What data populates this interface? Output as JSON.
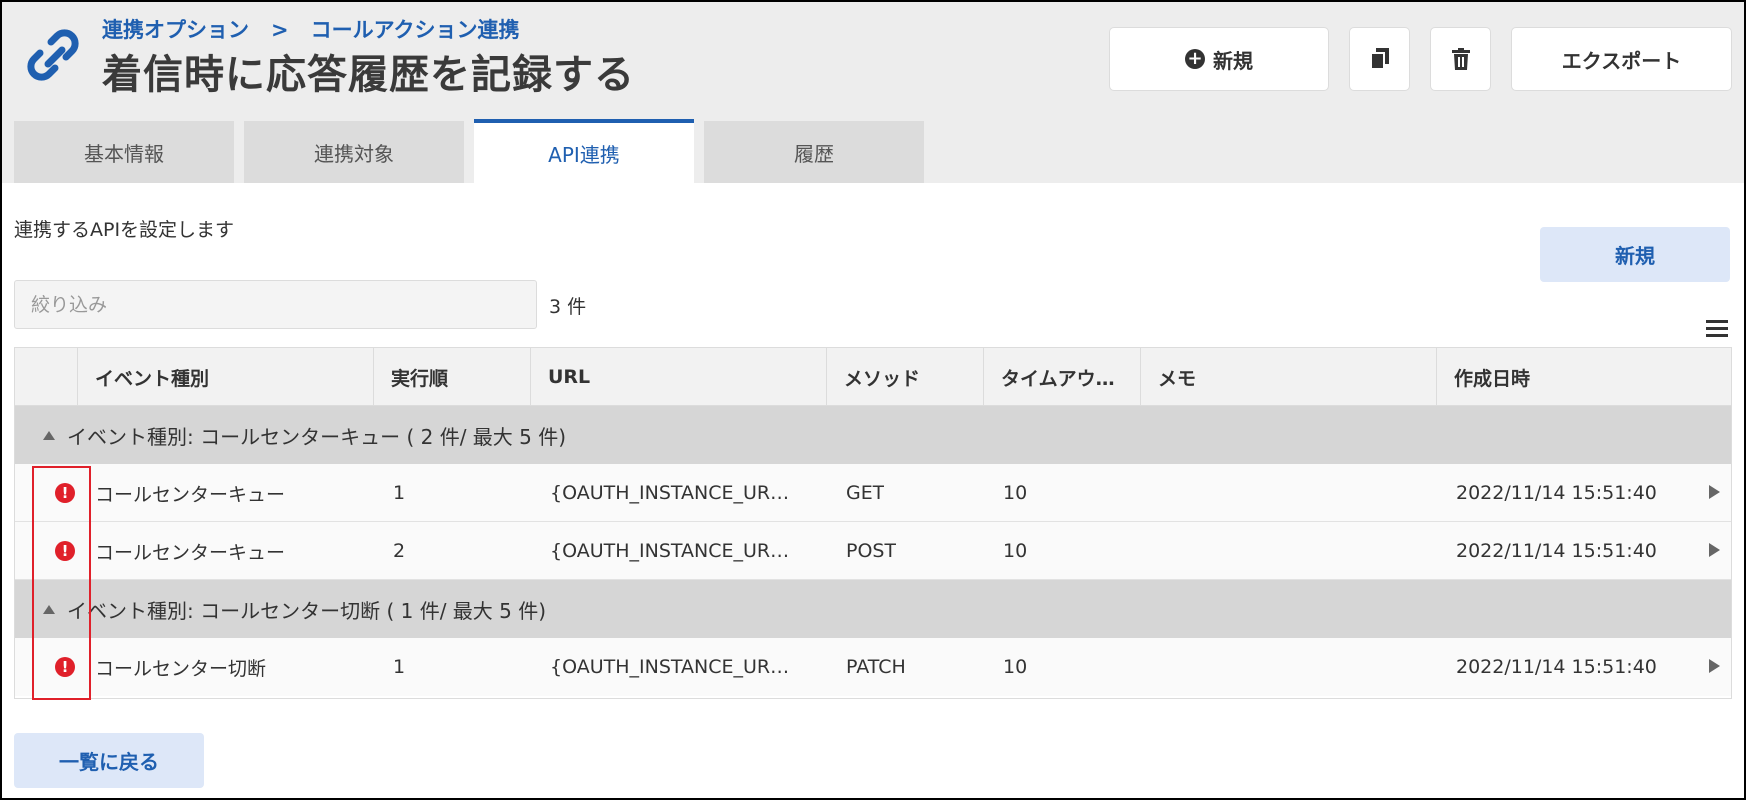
{
  "header": {
    "breadcrumb": [
      "連携オプション",
      "コールアクション連携"
    ],
    "breadcrumb_separator": ">",
    "title": "着信時に応答履歴を記録する",
    "icon": "link-icon",
    "actions": {
      "new_label": "新規",
      "copy_icon": "copy-icon",
      "delete_icon": "trash-icon",
      "export_label": "エクスポート"
    }
  },
  "tabs": [
    {
      "label": "基本情報",
      "active": false
    },
    {
      "label": "連携対象",
      "active": false
    },
    {
      "label": "API連携",
      "active": true
    },
    {
      "label": "履歴",
      "active": false
    }
  ],
  "content": {
    "description": "連携するAPIを設定します",
    "new_button": "新規",
    "filter_placeholder": "絞り込み",
    "count": "3 件",
    "back_button": "一覧に戻る"
  },
  "table": {
    "columns": [
      "イベント種別",
      "実行順",
      "URL",
      "メソッド",
      "タイムアウ…",
      "メモ",
      "作成日時"
    ],
    "groups": [
      {
        "label": "イベント種別: コールセンターキュー ( 2 件/ 最大 5 件)",
        "rows": [
          {
            "event": "コールセンターキュー",
            "order": "1",
            "url": "{OAUTH_INSTANCE_UR…",
            "method": "GET",
            "timeout": "10",
            "memo": "",
            "created": "2022/11/14 15:51:40"
          },
          {
            "event": "コールセンターキュー",
            "order": "2",
            "url": "{OAUTH_INSTANCE_UR…",
            "method": "POST",
            "timeout": "10",
            "memo": "",
            "created": "2022/11/14 15:51:40"
          }
        ]
      },
      {
        "label": "イベント種別: コールセンター切断 ( 1 件/ 最大 5 件)",
        "rows": [
          {
            "event": "コールセンター切断",
            "order": "1",
            "url": "{OAUTH_INSTANCE_UR…",
            "method": "PATCH",
            "timeout": "10",
            "memo": "",
            "created": "2022/11/14 15:51:40"
          }
        ]
      }
    ]
  },
  "colors": {
    "accent": "#1f5fb0",
    "error": "#e0202a",
    "highlight_box": "#e0202a"
  }
}
